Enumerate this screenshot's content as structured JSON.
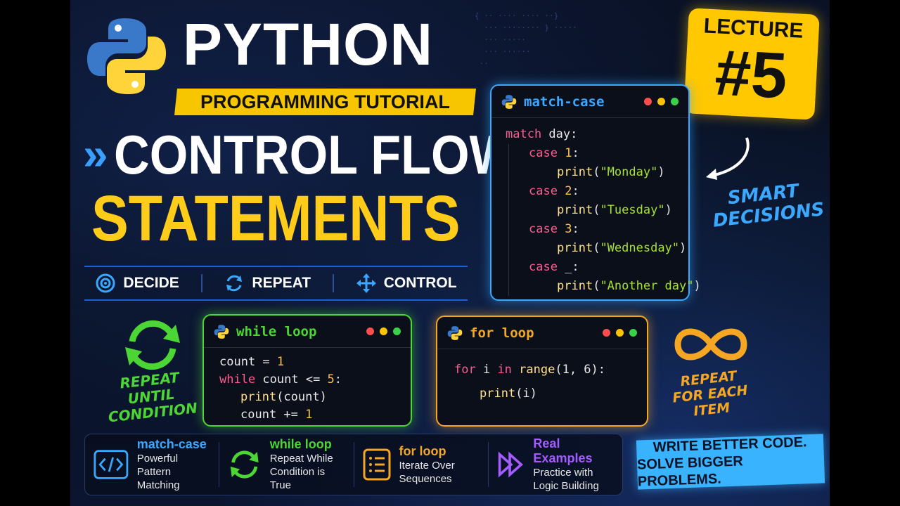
{
  "header": {
    "title": "PYTHON",
    "subtitle": "PROGRAMMING TUTORIAL",
    "headline_line1": "CONTROL FLOW",
    "headline_line2": "STATEMENTS"
  },
  "lecture": {
    "label": "LECTURE",
    "number": "#5"
  },
  "pills": [
    {
      "label": "DECIDE",
      "icon": "target-icon"
    },
    {
      "label": "REPEAT",
      "icon": "refresh-icon"
    },
    {
      "label": "CONTROL",
      "icon": "move-arrows-icon"
    }
  ],
  "match_card": {
    "title": "match-case",
    "lines": {
      "l1_kw": "match",
      "l1_rest": " day:",
      "c1_kw": "case",
      "c1_num": " 1",
      "c1_colon": ":",
      "p1_fn": "print",
      "p1_str": "\"Monday\"",
      "c2_kw": "case",
      "c2_num": " 2",
      "c2_colon": ":",
      "p2_fn": "print",
      "p2_str": "\"Tuesday\"",
      "c3_kw": "case",
      "c3_num": " 3",
      "c3_colon": ":",
      "p3_fn": "print",
      "p3_str": "\"Wednesday\"",
      "c4_kw": "case",
      "c4_rest": " _:",
      "p4_fn": "print",
      "p4_str": "\"Another day\""
    }
  },
  "smart_note": {
    "line1": "SMART",
    "line2": "DECISIONS"
  },
  "while_card": {
    "title": "while loop",
    "l1_a": "count = ",
    "l1_num": "1",
    "l2_kw": "while",
    "l2_rest": " count <= ",
    "l2_num": "5",
    "l2_colon": ":",
    "l3_fn": "print",
    "l3_rest": "(count)",
    "l4_a": "count += ",
    "l4_num": "1"
  },
  "while_note": {
    "line1": "REPEAT",
    "line2": "UNTIL",
    "line3": "CONDITION"
  },
  "for_card": {
    "title": "for loop",
    "l1_kw": "for",
    "l1_a": " i ",
    "l1_kw2": "in",
    "l1_fn": " range",
    "l1_rest": "(1, 6):",
    "l2_fn": "print",
    "l2_rest": "(i)"
  },
  "for_note": {
    "line1": "REPEAT",
    "line2": "FOR EACH",
    "line3": "ITEM"
  },
  "features": [
    {
      "title": "match-case",
      "desc1": "Powerful",
      "desc2": "Pattern Matching",
      "color": "#3aa8ff",
      "icon": "code-brackets-icon"
    },
    {
      "title": "while loop",
      "desc1": "Repeat While",
      "desc2": "Condition is True",
      "color": "#4cd635",
      "icon": "refresh-icon"
    },
    {
      "title": "for loop",
      "desc1": "Iterate Over",
      "desc2": "Sequences",
      "color": "#f5a623",
      "icon": "list-icon"
    },
    {
      "title": "Real Examples",
      "desc1": "Practice with",
      "desc2": "Logic Building",
      "color": "#a45cff",
      "icon": "fast-forward-icon"
    }
  ],
  "slogan": {
    "line1": "WRITE BETTER CODE.",
    "line2": "SOLVE BIGGER PROBLEMS."
  },
  "colors": {
    "yellow": "#ffcc1a",
    "blue": "#3aa8ff",
    "green": "#4cd635",
    "orange": "#f5a623",
    "purple": "#a45cff"
  }
}
